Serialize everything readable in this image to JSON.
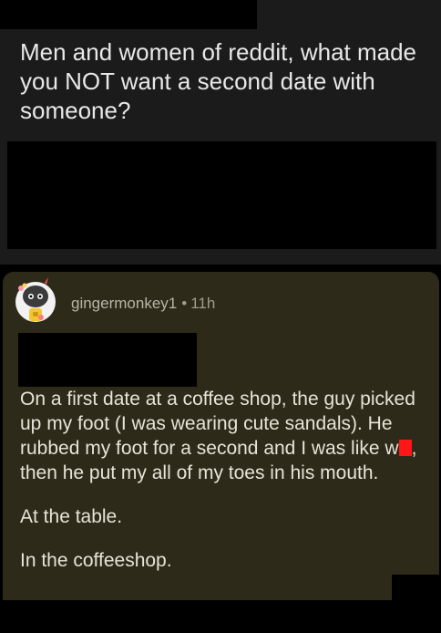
{
  "post": {
    "title": "Men and women of reddit, what made you NOT want a second date with someone?"
  },
  "comment": {
    "username": "gingermonkey1",
    "separator": "•",
    "age": "11h",
    "paragraphs": {
      "p1_before": "On a first date at a coffee shop, the guy picked up my foot (I was wearing cute sandals). He rubbed my foot for a second and I was like w",
      "p1_after": ", then he put my all of my toes in his mouth.",
      "p2": "At the table.",
      "p3": "In the coffeeshop."
    }
  },
  "colors": {
    "post_background": "#1b1b1b",
    "comment_background": "#2d2a19",
    "title_text": "#e8e8e8",
    "comment_text": "#e6e3d8",
    "meta_text": "#a09d90",
    "redaction": "#000000",
    "red_mark": "#ff1616"
  }
}
